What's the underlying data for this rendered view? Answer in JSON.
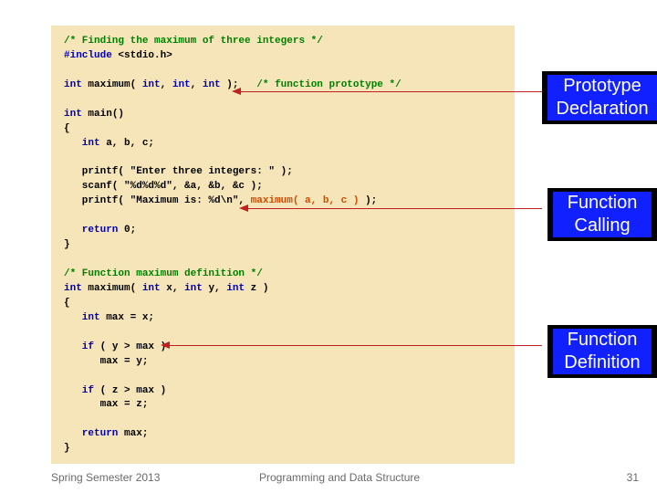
{
  "code": {
    "c1": "/* Finding the maximum of three integers */",
    "inc1": "#include",
    "inc2": " <stdio.h>",
    "proto1": "int",
    "proto2": " maximum( ",
    "proto3": "int",
    "proto4": ", ",
    "proto5": "int",
    "proto6": ", ",
    "proto7": "int",
    "proto8": " );   ",
    "proto9": "/* function prototype */",
    "main1": "int",
    "main2": " main()",
    "brace1": "{",
    "decl1": "   int",
    "decl2": " a, b, c;",
    "p1": "   printf( \"Enter three integers: \" );",
    "p2": "   scanf( \"%d%d%d\", &a, &b, &c );",
    "p3a": "   printf( \"Maximum is: %d\\n\", ",
    "p3b": "maximum( a, b, c )",
    "p3c": " );",
    "ret1": "   return",
    "ret2": " 0;",
    "brace2": "}",
    "fc1": "/* Function maximum definition */",
    "fd1": "int",
    "fd2": " maximum( ",
    "fd3": "int",
    "fd4": " x, ",
    "fd5": "int",
    "fd6": " y, ",
    "fd7": "int",
    "fd8": " z )",
    "brace3": "{",
    "mx1": "   int",
    "mx2": " max = x;",
    "if1a": "   if",
    "if1b": " ( y > max )",
    "if1c": "      max = y;",
    "if2a": "   if",
    "if2b": " ( z > max )",
    "if2c": "      max = z;",
    "retm1": "   return",
    "retm2": " max;",
    "brace4": "}"
  },
  "annot": {
    "proto1": "Prototype",
    "proto2": "Declaration",
    "call1": "Function",
    "call2": "Calling",
    "def1": "Function",
    "def2": "Definition"
  },
  "footer": {
    "left": "Spring Semester 2013",
    "mid": "Programming and Data Structure",
    "right": "31"
  }
}
